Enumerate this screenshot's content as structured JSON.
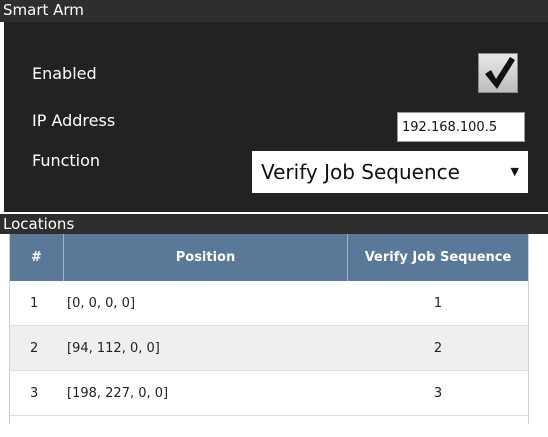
{
  "smart_arm": {
    "title": "Smart Arm",
    "enabled_label": "Enabled",
    "enabled_checked": true,
    "ip_label": "IP Address",
    "ip_value": "192.168.100.5",
    "function_label": "Function",
    "function_value": "Verify Job Sequence"
  },
  "locations": {
    "title": "Locations",
    "columns": [
      "#",
      "Position",
      "Verify Job Sequence"
    ],
    "rows": [
      {
        "num": "1",
        "position": "[0, 0, 0, 0]",
        "verify": "1"
      },
      {
        "num": "2",
        "position": "[94, 112, 0, 0]",
        "verify": "2"
      },
      {
        "num": "3",
        "position": "[198, 227, 0, 0]",
        "verify": "3"
      }
    ]
  },
  "colors": {
    "header_bg": "#2e2e2e",
    "panel_bg": "#222222",
    "table_header_bg": "#5a7898",
    "row_alt_bg": "#efefef"
  },
  "icons": {
    "checkbox": "checkmark-icon",
    "dropdown": "dropdown-arrow-icon"
  }
}
